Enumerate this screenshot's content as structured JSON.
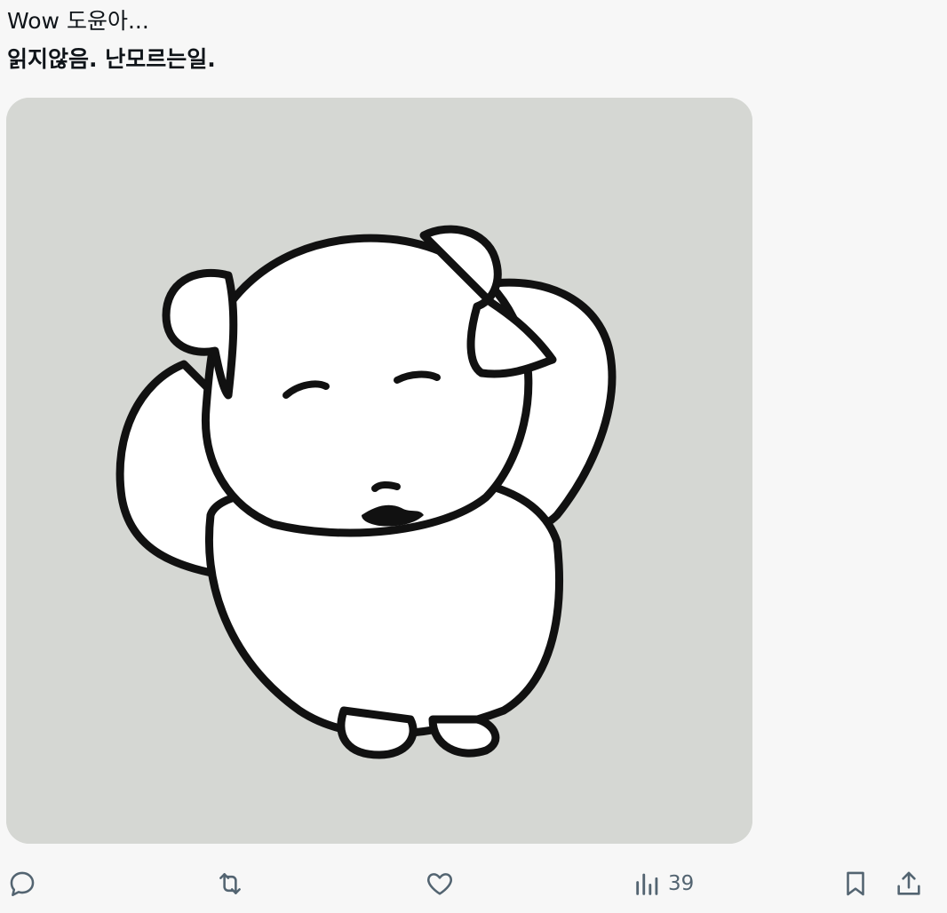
{
  "post": {
    "text_line_1": "Wow 도윤아...",
    "text_line_2": "읽지않음. 난모르는일."
  },
  "media": {
    "alt": "cartoon white puppy holding its head with eyes closed",
    "background_color": "#d5d7d3"
  },
  "actions": {
    "reply_icon": "reply-icon",
    "repost_icon": "repost-icon",
    "like_icon": "heart-icon",
    "views_icon": "views-icon",
    "views_count": "39",
    "bookmark_icon": "bookmark-icon",
    "share_icon": "share-icon",
    "icon_color": "#536471"
  }
}
